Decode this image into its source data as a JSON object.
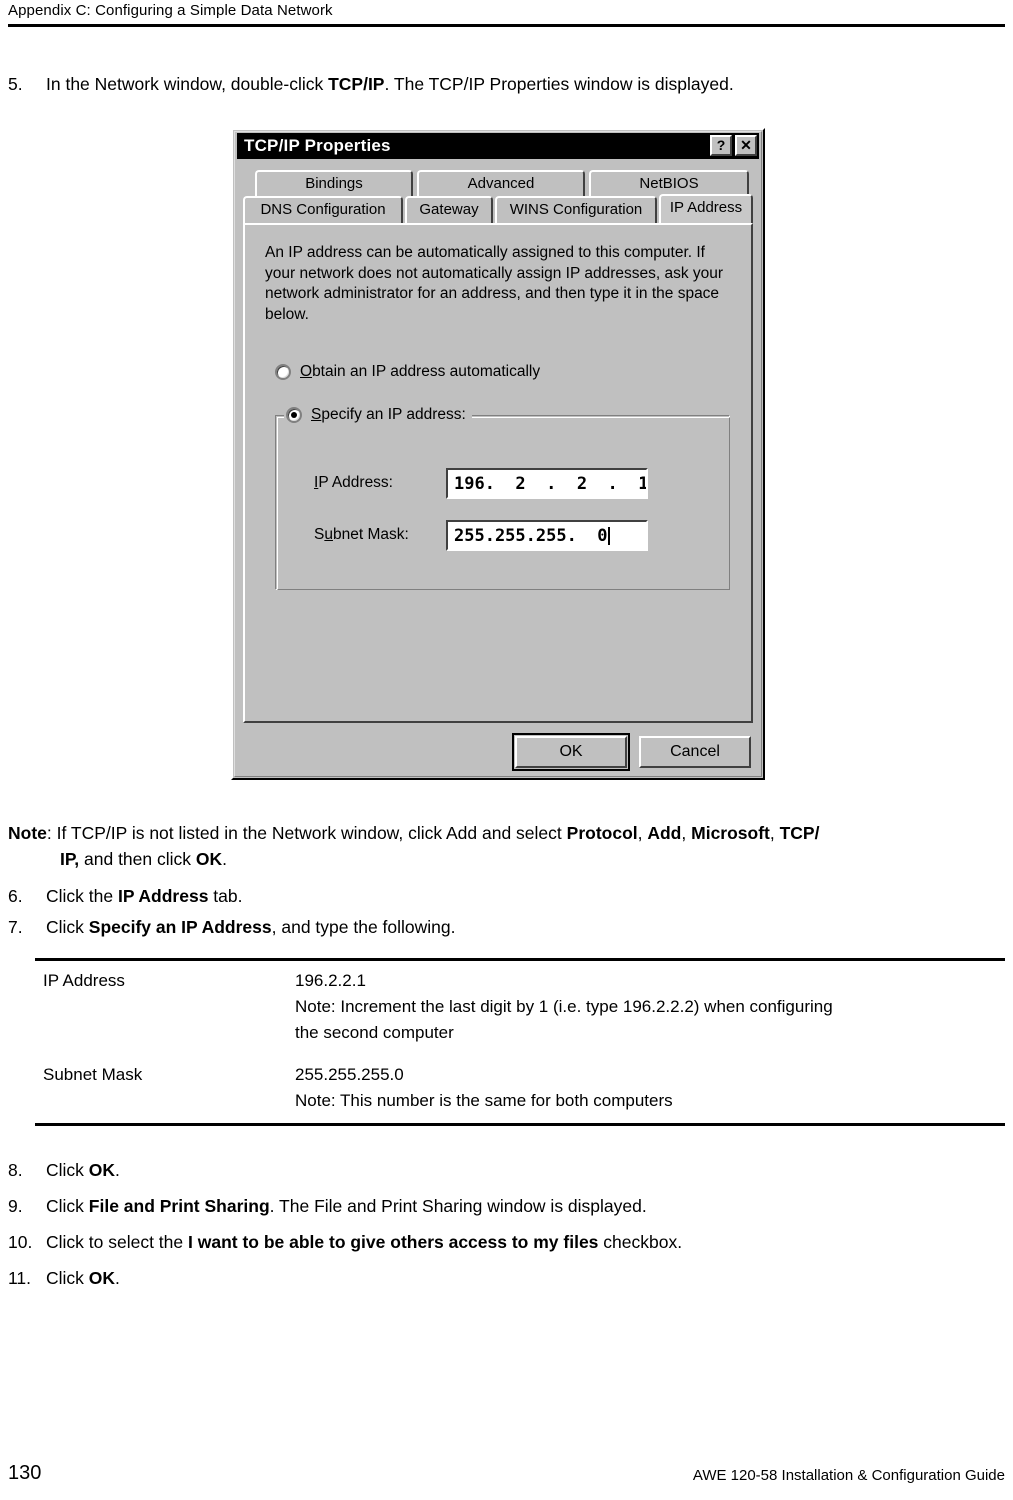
{
  "page": {
    "running_head": "Appendix C: Configuring a Simple Data Network",
    "page_number": "130",
    "footer_right": "AWE 120-58 Installation & Configuration Guide"
  },
  "steps": {
    "step5": {
      "num": "5.",
      "text_before": "In the Network window, double-click ",
      "bold": "TCP/IP",
      "text_after": ". The TCP/IP Properties window is displayed."
    },
    "step6": {
      "num": "6.",
      "text_before": "Click the ",
      "bold": "IP Address",
      "text_after": " tab."
    },
    "step7": {
      "num": "7.",
      "text_before": "Click ",
      "bold": "Specify an IP Address",
      "text_after": ", and type the following."
    },
    "step8": {
      "num": "8.",
      "text_before": "Click ",
      "bold": "OK",
      "text_after": "."
    },
    "step9": {
      "num": "9.",
      "text_before": "Click ",
      "bold": "File and Print Sharing",
      "text_after": ". The File and Print Sharing window is displayed."
    },
    "step10": {
      "num": "10.",
      "text_before": "Click to select the ",
      "bold": "I want to be able to give others access to my files",
      "text_after": " checkbox."
    },
    "step11": {
      "num": "11.",
      "text_before": "Click ",
      "bold": "OK",
      "text_after": "."
    }
  },
  "note": {
    "label": "Note",
    "line1_a": ": If TCP/IP is not listed in the Network window, click Add and select ",
    "b1": "Protocol",
    "sep1": ", ",
    "b2": "Add",
    "sep2": ", ",
    "b3": "Microsoft",
    "sep3": ", ",
    "b4": "TCP/",
    "line2_b": "IP,",
    "line2_a": " and then click ",
    "b5": "OK",
    "line2_end": "."
  },
  "dialog": {
    "title": "TCP/IP Properties",
    "help_button": "?",
    "close_button": "✕",
    "tabs_row1": [
      {
        "label": "Bindings",
        "selected": false
      },
      {
        "label": "Advanced",
        "selected": false
      },
      {
        "label": "NetBIOS",
        "selected": false
      }
    ],
    "tabs_row2": [
      {
        "label": "DNS Configuration",
        "selected": false
      },
      {
        "label": "Gateway",
        "selected": false
      },
      {
        "label": "WINS Configuration",
        "selected": false
      },
      {
        "label": "IP Address",
        "selected": true
      }
    ],
    "intro_text": "An IP address can be automatically assigned to this computer. If your network does not automatically assign IP addresses, ask your network administrator for an address, and then type it in the space below.",
    "radio_obtain": {
      "label_accel": "O",
      "label_rest": "btain an IP address automatically",
      "checked": false
    },
    "radio_specify": {
      "label_pre": "",
      "label_accel": "S",
      "label_rest": "pecify an IP address:",
      "checked": true
    },
    "field_ip": {
      "label_accel": "I",
      "label_rest": "P Address:",
      "value": "196.  2  .  2  .  1"
    },
    "field_subnet": {
      "label_pre": "S",
      "label_accel": "u",
      "label_rest": "bnet Mask:",
      "value": "255.255.255.  0"
    },
    "ok_button": "OK",
    "cancel_button": "Cancel"
  },
  "table": {
    "rows": [
      {
        "key": "IP Address",
        "value_line1": "196.2.2.1",
        "value_line2": "Note: Increment the last digit by 1 (i.e. type 196.2.2.2) when configuring",
        "value_line3": "the second computer"
      },
      {
        "key": "Subnet Mask",
        "value_line1": "255.255.255.0",
        "value_line2": "Note: This number is the same for both computers",
        "value_line3": ""
      }
    ]
  },
  "colors": {
    "dialog_face": "#c0c0c0",
    "titlebar": "#000000",
    "field_bg": "#ffffff",
    "text": "#000000"
  }
}
